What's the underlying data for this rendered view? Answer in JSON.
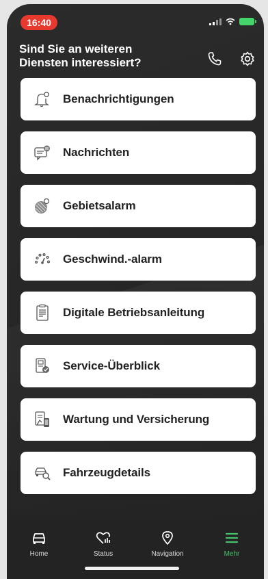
{
  "status": {
    "time": "16:40"
  },
  "header": {
    "title_line1": "Sind Sie an weiteren",
    "title_line2": "Diensten interessiert?"
  },
  "menu": [
    {
      "label": "Benachrichtigungen",
      "icon": "bell-icon"
    },
    {
      "label": "Nachrichten",
      "icon": "message-icon"
    },
    {
      "label": "Gebietsalarm",
      "icon": "area-alarm-icon"
    },
    {
      "label": "Geschwind.-alarm",
      "icon": "speedometer-icon"
    },
    {
      "label": "Digitale Betriebsanleitung",
      "icon": "manual-icon"
    },
    {
      "label": "Service-Überblick",
      "icon": "service-overview-icon"
    },
    {
      "label": "Wartung und Versicherung",
      "icon": "maintenance-insurance-icon"
    },
    {
      "label": "Fahrzeugdetails",
      "icon": "vehicle-details-icon"
    }
  ],
  "tabs": [
    {
      "label": "Home",
      "icon": "car-icon"
    },
    {
      "label": "Status",
      "icon": "heart-status-icon"
    },
    {
      "label": "Navigation",
      "icon": "location-pin-icon"
    },
    {
      "label": "Mehr",
      "icon": "menu-icon",
      "active": true
    }
  ],
  "colors": {
    "accent": "#46c36a",
    "time_pill": "#e8392f",
    "background": "#262626"
  }
}
